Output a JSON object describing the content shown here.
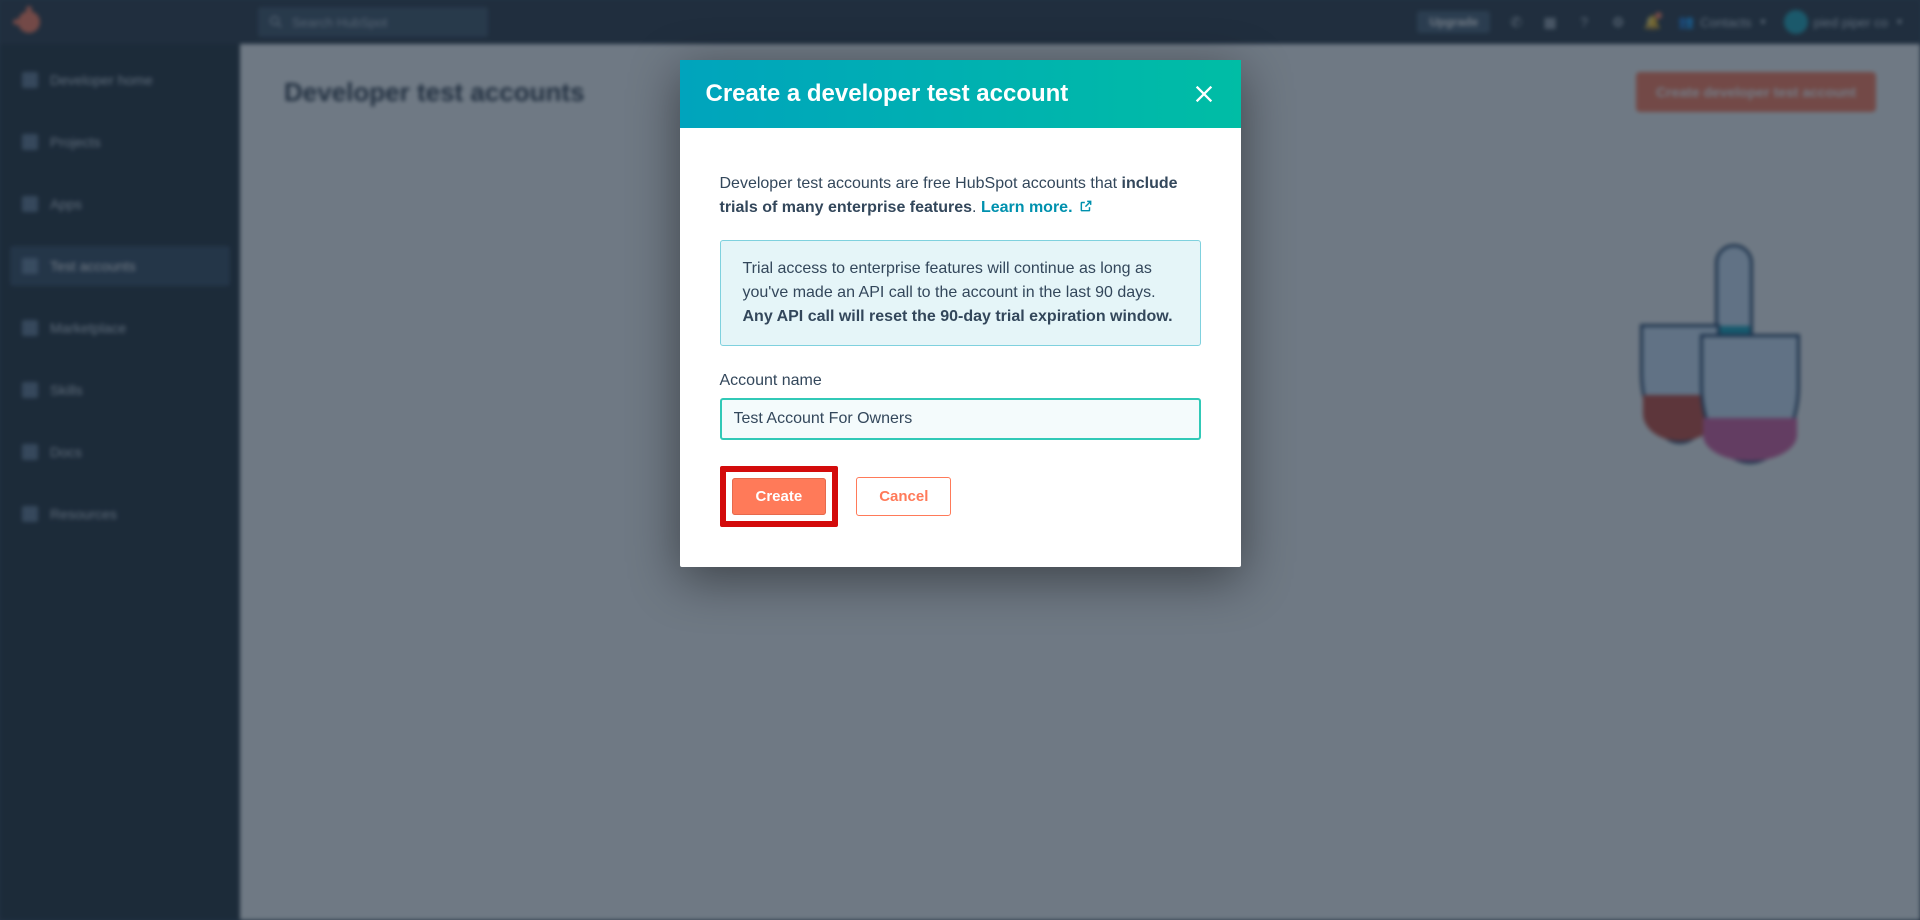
{
  "topbar": {
    "search_placeholder": "Search HubSpot",
    "upgrade": "Upgrade",
    "contacts": "Contacts",
    "account_label": "pied piper co"
  },
  "sidebar": {
    "items": [
      {
        "label": "Developer home"
      },
      {
        "label": "Projects"
      },
      {
        "label": "Apps"
      },
      {
        "label": "Test accounts"
      },
      {
        "label": "Marketplace"
      },
      {
        "label": "Skills"
      },
      {
        "label": "Docs"
      },
      {
        "label": "Resources"
      }
    ]
  },
  "main": {
    "title": "Developer test accounts",
    "cta": "Create developer test account"
  },
  "modal": {
    "title": "Create a developer test account",
    "desc_pre": "Developer test accounts are free HubSpot accounts that ",
    "desc_bold": "include trials of many enterprise features",
    "desc_post": ". ",
    "learn_more": "Learn more.",
    "info_pre": "Trial access to enterprise features will continue as long as you've made an API call to the account in the last 90 days. ",
    "info_bold": "Any API call will reset the 90-day trial expiration window.",
    "field_label": "Account name",
    "field_value": "Test Account For Owners",
    "btn_create": "Create",
    "btn_cancel": "Cancel"
  }
}
